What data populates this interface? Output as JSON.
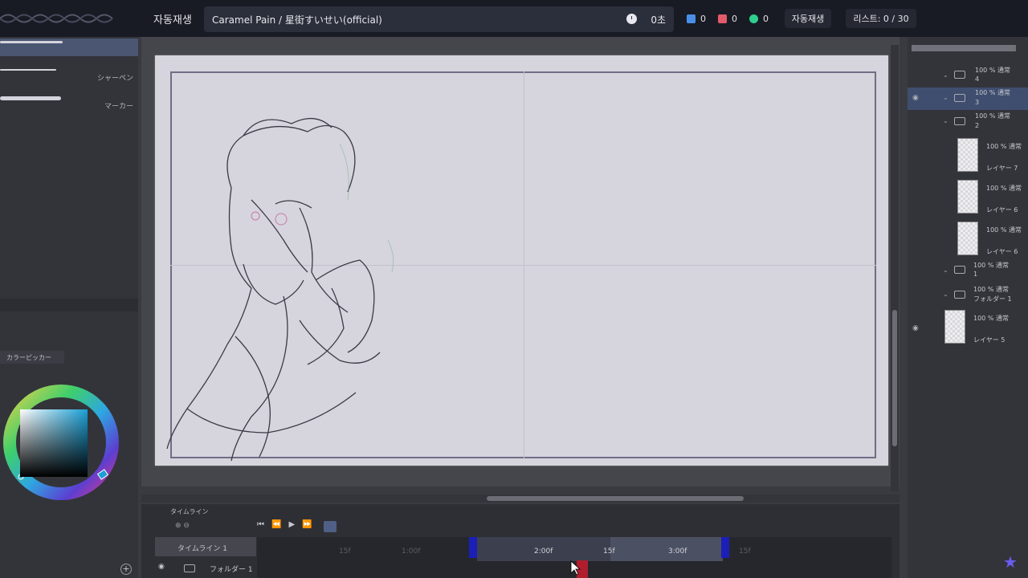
{
  "player": {
    "title": "자동재생",
    "song": "Caramel Pain / 星街すいせい(official)",
    "duration": "0초",
    "likes": "0",
    "dislikes": "0",
    "views": "0",
    "autoplay_button": "자동재생",
    "playlist": "리스트: 0 / 30"
  },
  "brushes": [
    "シャーペン",
    "マーカー"
  ],
  "color_picker": {
    "tab": "カラーピッカー"
  },
  "layers": [
    {
      "mode": "100 % 通常",
      "name": "4"
    },
    {
      "mode": "100 % 通常",
      "name": "3"
    },
    {
      "mode": "100 % 通常",
      "name": "2"
    },
    {
      "mode": "100 % 通常",
      "name": "レイヤー 7"
    },
    {
      "mode": "100 % 通常",
      "name": "レイヤー 6"
    },
    {
      "mode": "100 % 通常",
      "name": "レイヤー 6"
    },
    {
      "mode": "100 % 通常",
      "name": "1"
    },
    {
      "mode": "100 % 通常",
      "name": "フォルダー 1"
    },
    {
      "mode": "100 % 通常",
      "name": "レイヤー 5"
    }
  ],
  "timeline": {
    "tab": "タイムライン",
    "name": "タイムライン 1",
    "folder": "フォルダー 1",
    "ticks": [
      "15f",
      "1:00f",
      "2:00f",
      "15f",
      "3:00f",
      "15f"
    ]
  },
  "colors": {
    "accent": "#1b1fb8",
    "playhead": "#b01e2e",
    "like": "#4a8fe7",
    "dislike": "#e25b6b",
    "view": "#2ecf8f"
  }
}
